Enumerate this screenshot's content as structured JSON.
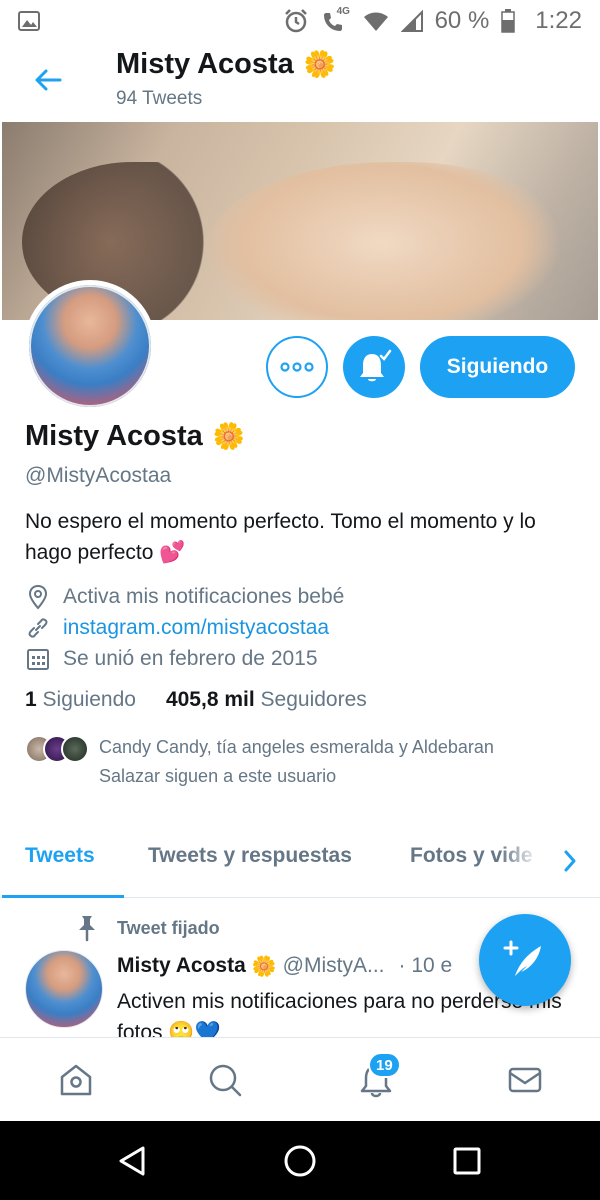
{
  "status_bar": {
    "network": "4G",
    "battery": "60 %",
    "time": "1:22"
  },
  "header": {
    "title": "Misty Acosta",
    "tweet_count": "94 Tweets"
  },
  "profile": {
    "name": "Misty Acosta",
    "handle": "@MistyAcostaa",
    "bio": "No espero el momento perfecto. Tomo el momento y lo hago perfecto",
    "location": "Activa mis notificaciones bebé",
    "website": "instagram.com/mistyacostaa",
    "joined": "Se unió en febrero de 2015",
    "following_count": "1",
    "following_label": "Siguiendo",
    "followers_count": "405,8 mil",
    "followers_label": "Seguidores",
    "known_followers": "Candy Candy, tía angeles esmeralda y Aldebaran Salazar siguen a este usuario"
  },
  "actions": {
    "following_button": "Siguiendo"
  },
  "tabs": [
    {
      "label": "Tweets",
      "active": true
    },
    {
      "label": "Tweets y respuestas",
      "active": false
    },
    {
      "label": "Fotos y vide",
      "active": false
    }
  ],
  "pinned_tweet": {
    "pinned_label": "Tweet fijado",
    "name": "Misty Acosta",
    "handle": "@MistyA...",
    "date": "· 10 e",
    "text": "Activen mis notificaciones para no perderse mis fotos"
  },
  "bottom_nav": {
    "notifications_badge": "19"
  },
  "colors": {
    "accent": "#1da1f2",
    "text_primary": "#14171a",
    "text_secondary": "#657786",
    "link": "#1b95e0"
  },
  "icons": {
    "back": "arrow-left-icon",
    "more": "more-horizontal-icon",
    "bell": "bell-check-icon",
    "location": "location-pin-icon",
    "link": "link-icon",
    "calendar": "calendar-icon",
    "pin": "pin-icon",
    "compose": "compose-feather-icon",
    "home": "home-icon",
    "search": "search-icon",
    "notifications": "bell-icon",
    "messages": "envelope-icon"
  }
}
